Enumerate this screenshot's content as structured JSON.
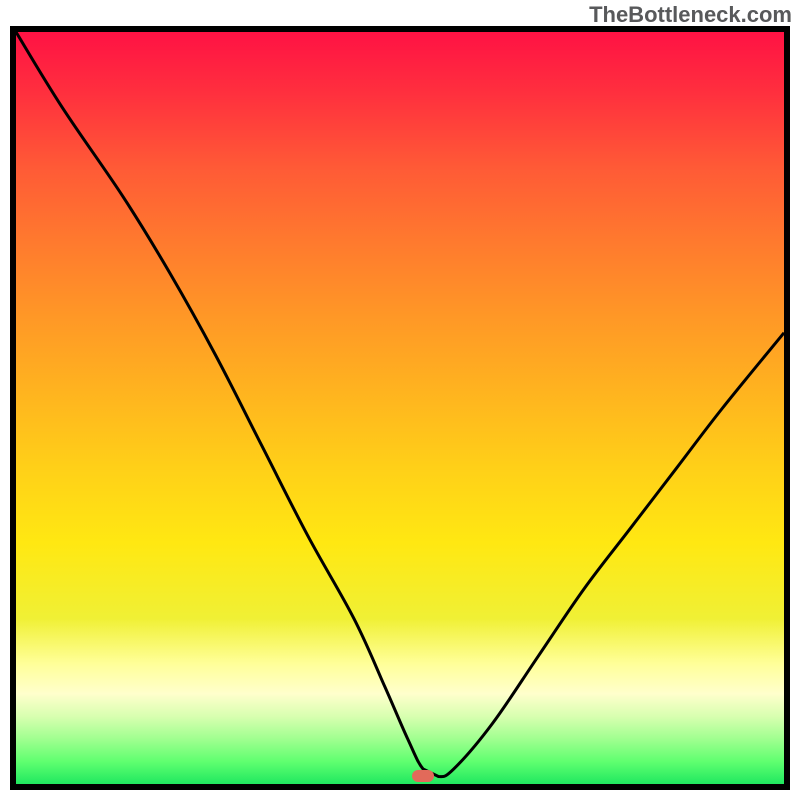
{
  "watermark": "TheBottleneck.com",
  "chart_data": {
    "type": "line",
    "title": "",
    "xlabel": "",
    "ylabel": "",
    "xlim": [
      0,
      100
    ],
    "ylim": [
      0,
      100
    ],
    "series": [
      {
        "name": "curve",
        "x": [
          0,
          6,
          14,
          20,
          26,
          32,
          38,
          44,
          48,
          51,
          53,
          55,
          57,
          62,
          68,
          74,
          80,
          86,
          92,
          100
        ],
        "values": [
          100,
          90,
          78,
          68,
          57,
          45,
          33,
          22,
          13,
          6,
          2,
          1,
          2,
          8,
          17,
          26,
          34,
          42,
          50,
          60
        ]
      }
    ],
    "flat_region_x": [
      50,
      55
    ],
    "marker": {
      "x": 53,
      "y": 1
    },
    "background_gradient": {
      "top_color": "#ff1244",
      "mid_color": "#ffd018",
      "bottom_color": "#20e860"
    }
  }
}
